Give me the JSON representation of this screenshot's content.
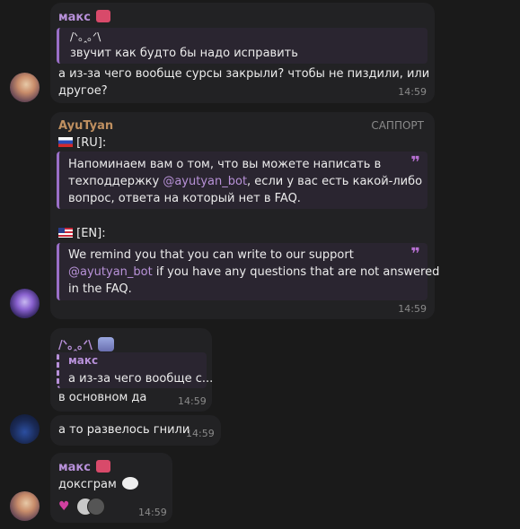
{
  "msg1": {
    "sender": "макс",
    "reply_name": "/ᐠ｡ꞈ｡ᐟ\\",
    "reply_text": "звучит как будто бы надо исправить",
    "text_line1": "а из-за чего вообще сурсы закрыли? чтобы не пиздили, или",
    "text_line2": "другое?",
    "time": "14:59"
  },
  "msg2": {
    "sender": "AyuTyan",
    "badge": "САППОРТ",
    "ru_flag": "🇷🇺",
    "ru_label": "[RU]:",
    "ru_line1": "Напоминаем вам о том, что вы можете написать в",
    "ru_line2a": "техподдержку ",
    "ru_mention": "@ayutyan_bot",
    "ru_line2b": ", если у вас есть какой-либо",
    "ru_line3": "вопрос, ответа на который нет в FAQ.",
    "en_flag": "🇺🇸",
    "en_label": "[EN]:",
    "en_line1": "We remind you that you can write to our support",
    "en_mention": "@ayutyan_bot",
    "en_line2b": " if you have any questions that are not answered",
    "en_line3": "in the FAQ.",
    "time": "14:59"
  },
  "msg3": {
    "sender": "/ᐠ｡ꞈ｡ᐟ\\",
    "reply_name": "макс",
    "reply_text": "а из-за чего вообще с...",
    "text": "в основном да",
    "time": "14:59"
  },
  "msg4": {
    "text": "а то разв елось гнили",
    "time": "14:59"
  },
  "msg5": {
    "sender": "макс",
    "text": "доксграм",
    "time": "14:59"
  },
  "colors": {
    "background": "#1a1a1a",
    "bubble": "#222224",
    "name_purple": "#b790d9",
    "quote_bar": "#9a6fc8",
    "support_name": "#c09060"
  }
}
